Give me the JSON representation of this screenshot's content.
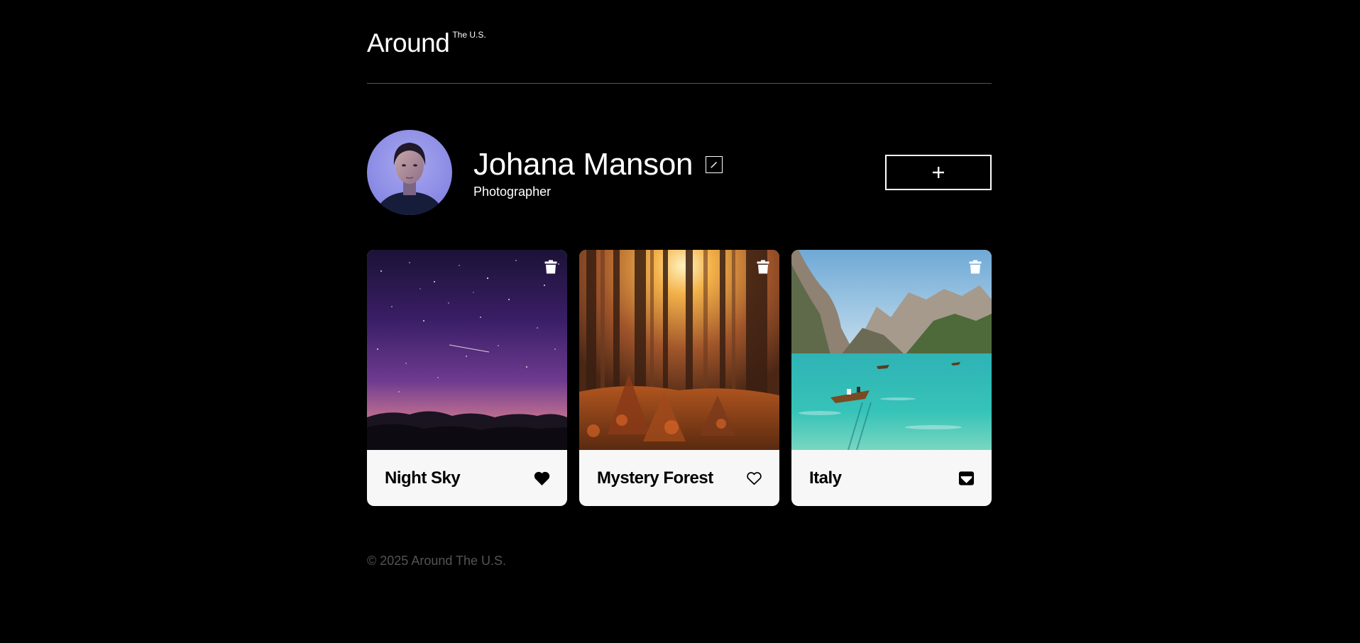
{
  "header": {
    "logo_main": "Around",
    "logo_sup": "The U.S."
  },
  "profile": {
    "name": "Johana Manson",
    "job": "Photographer",
    "add_label": "+"
  },
  "cards": [
    {
      "title": "Night Sky",
      "liked": true,
      "like_icon": "heart-filled-icon"
    },
    {
      "title": "Mystery Forest",
      "liked": false,
      "like_icon": "heart-outline-icon"
    },
    {
      "title": "Italy",
      "liked": false,
      "like_icon": "heart-box-icon"
    }
  ],
  "footer": {
    "copyright": "© 2025 Around The U.S."
  },
  "colors": {
    "background": "#000000",
    "card": "#f7f7f7",
    "divider": "#545454",
    "footer_text": "#545454"
  }
}
